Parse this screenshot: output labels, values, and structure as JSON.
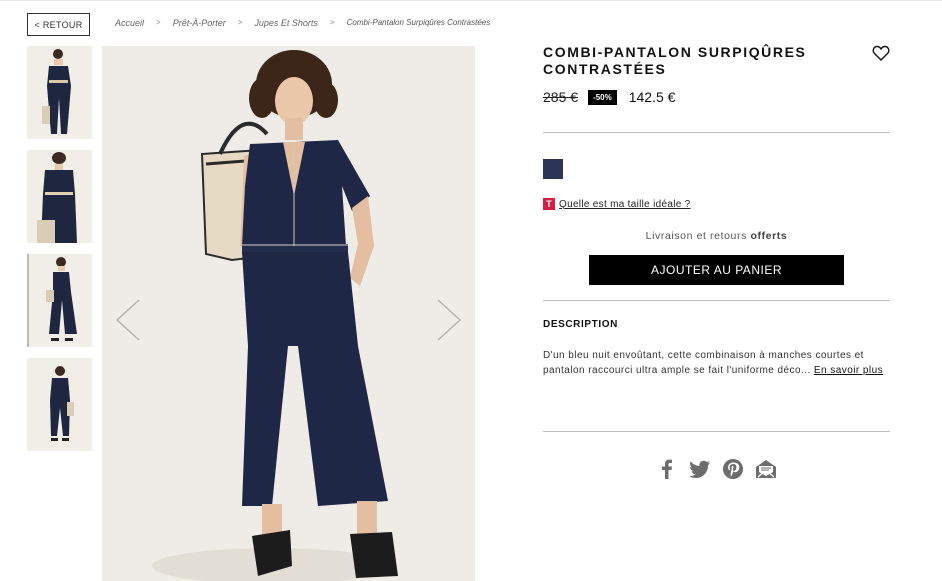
{
  "nav": {
    "back_label": "< RETOUR"
  },
  "breadcrumb": {
    "items": [
      "Accueil",
      "Prêt-À-Porter",
      "Jupes Et Shorts"
    ],
    "current": "Combi-Pantalon Surpiqûres Contrastées",
    "separator": ">"
  },
  "product": {
    "title": "COMBI-PANTALON SURPIQÛRES CONTRASTÉES",
    "old_price": "285 €",
    "discount": "-50%",
    "new_price": "142.5 €",
    "color_swatch": "#2d3556",
    "size_help_icon": "T",
    "size_help": "Quelle est ma taille idéale ?",
    "delivery_text": "Livraison et retours",
    "delivery_bold": "offerts",
    "add_to_cart": "AJOUTER AU PANIER",
    "description_title": "DESCRIPTION",
    "description": "D'un bleu nuit envoûtant, cette combinaison à manches courtes et pantalon raccourci ultra ample se fait l'uniforme déco...",
    "read_more": "En savoir plus"
  },
  "gallery": {
    "thumb_count": 4,
    "active_thumb": 3
  },
  "share": {
    "icons": [
      "facebook-icon",
      "twitter-icon",
      "pinterest-icon",
      "email-icon"
    ]
  },
  "colors": {
    "accent": "#000000",
    "navy": "#2d3556",
    "size_badge": "#d71f45"
  }
}
